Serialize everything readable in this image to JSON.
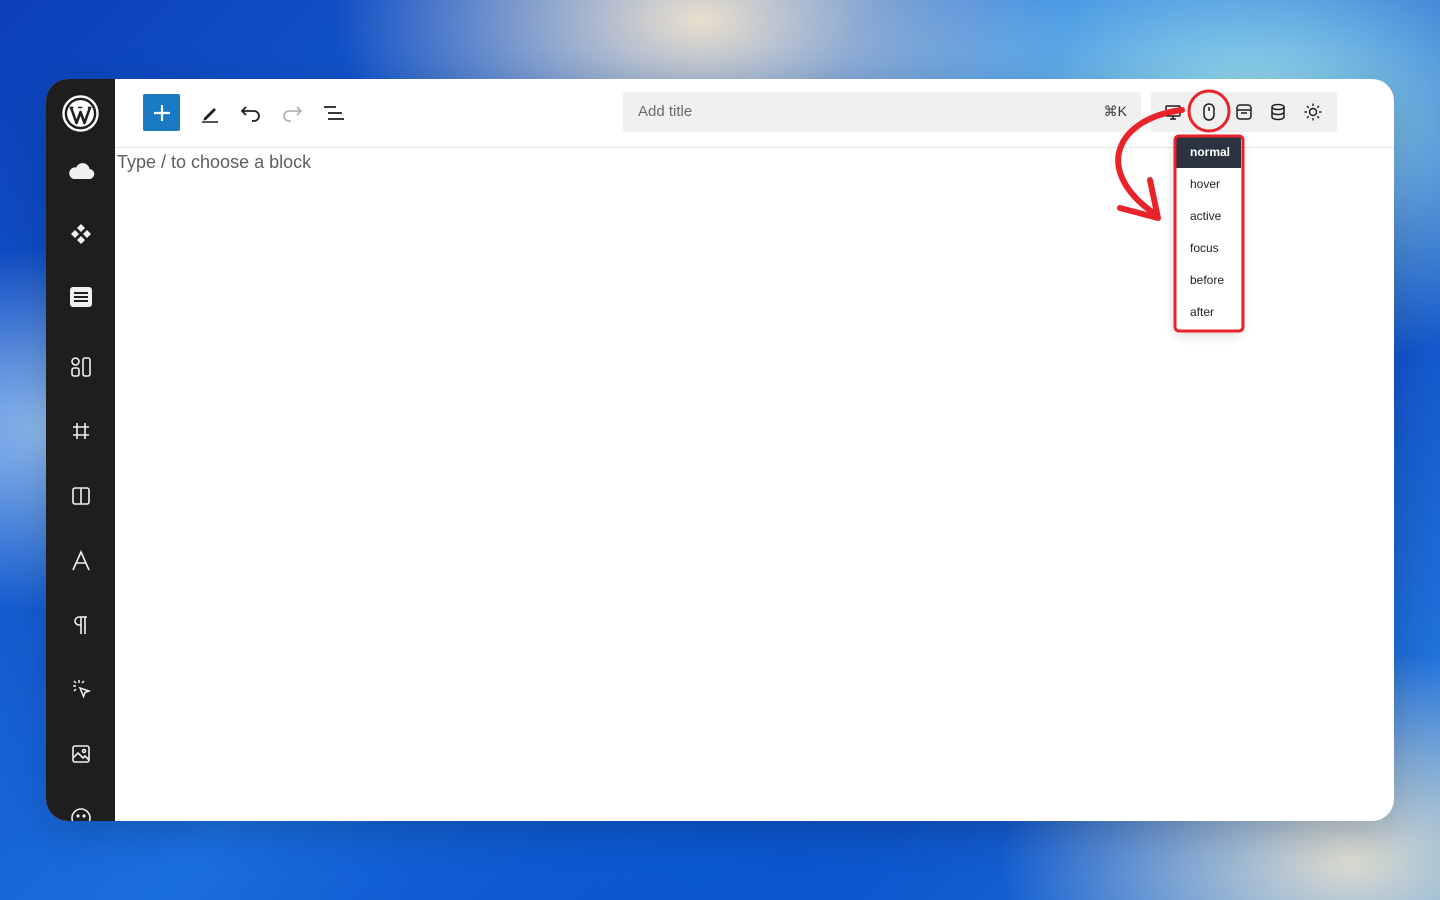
{
  "toolbar": {
    "search_placeholder": "Add title",
    "search_shortcut": "⌘K"
  },
  "editor": {
    "placeholder": "Type / to choose a block"
  },
  "state_menu": {
    "items": [
      "normal",
      "hover",
      "active",
      "focus",
      "before",
      "after"
    ],
    "selected": "normal"
  },
  "colors": {
    "accent": "#1a7bc4",
    "sidebar_bg": "#1e1e1e",
    "dropdown_selected_bg": "#2b3240",
    "annotation_red": "#e8232a"
  }
}
